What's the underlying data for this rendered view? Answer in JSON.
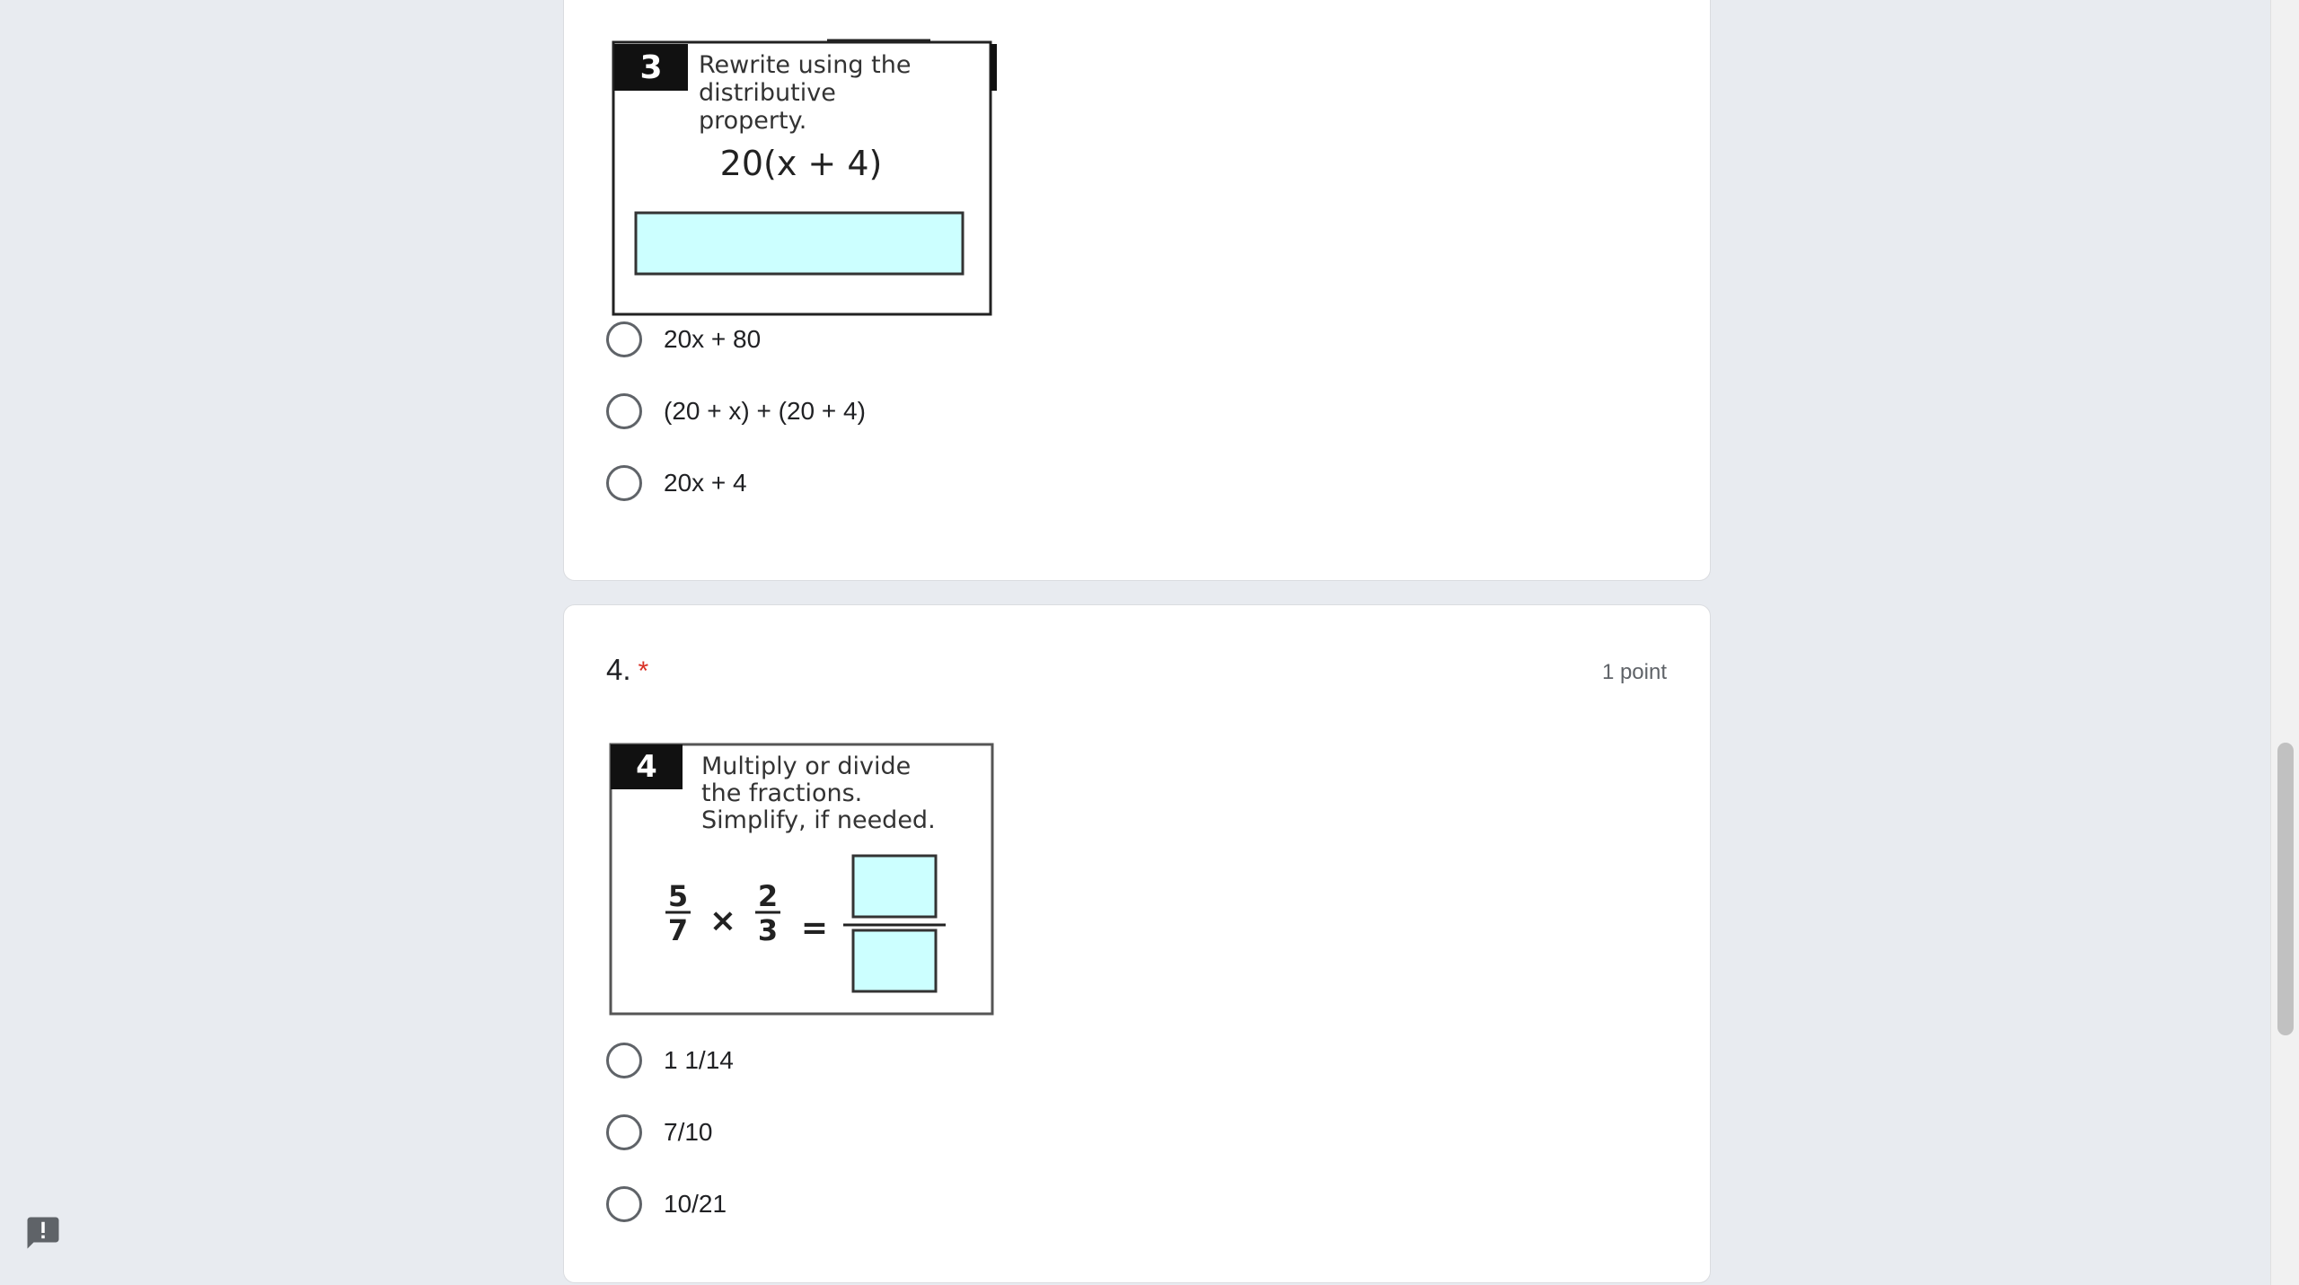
{
  "questions": [
    {
      "number": "3",
      "image": {
        "badge": "3",
        "instruction_lines": [
          "Rewrite using the",
          "distributive",
          "property."
        ],
        "expression": "20(x + 4)"
      },
      "options": [
        "20x + 80",
        "(20 + x) + (20 + 4)",
        "20x + 4"
      ]
    },
    {
      "number": "4.",
      "required_mark": "*",
      "points": "1 point",
      "image": {
        "badge": "4",
        "instruction_lines": [
          "Multiply or divide",
          "the fractions.",
          "Simplify, if needed."
        ],
        "fraction_a": {
          "num": "5",
          "den": "7"
        },
        "operator": "×",
        "fraction_b": {
          "num": "2",
          "den": "3"
        },
        "equals": "="
      },
      "options": [
        "1 1/14",
        "7/10",
        "10/21"
      ]
    }
  ],
  "colors": {
    "page_background": "#e8ebf0",
    "answer_box": "#ccffff",
    "required": "#d93025"
  },
  "icons": {
    "feedback": "report-feedback-icon",
    "radio": "radio-unchecked-icon"
  }
}
